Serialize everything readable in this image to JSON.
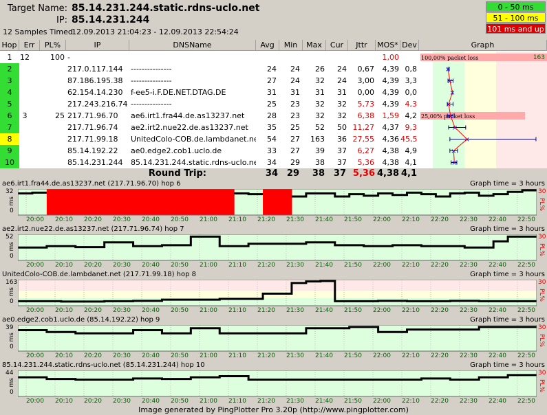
{
  "header": {
    "target_label": "Target Name:",
    "target_value": "85.14.231.244.static.rdns-uclo.net",
    "ip_label": "IP:",
    "ip_value": "85.14.231.244",
    "samples_label": "12 Samples Timed:",
    "samples_value": "12.09.2013 21:04:23 - 12.09.2013 22:54:24",
    "legend": [
      {
        "label": "0 - 50 ms",
        "bg": "#33dd33",
        "fg": "#000000"
      },
      {
        "label": "51 - 100 ms",
        "bg": "#ffff00",
        "fg": "#000000"
      },
      {
        "label": "101 ms and up",
        "bg": "#e00000",
        "fg": "#ffffff"
      }
    ]
  },
  "columns": [
    "Hop",
    "Err",
    "PL%",
    "IP",
    "DNSName",
    "Avg",
    "Min",
    "Max",
    "Cur",
    "Jttr",
    "MOS*",
    "Dev",
    "Graph"
  ],
  "rows": [
    {
      "hop": "1",
      "err": "12",
      "pl": "100",
      "ip": "-",
      "dns": "",
      "avg": "",
      "min": "",
      "max": "",
      "cur": "",
      "jttr": "",
      "mos": "1,00",
      "dev": "",
      "hopcolor": "white",
      "mosred": true,
      "jttrred": false,
      "devred": false,
      "pltext": "100,00% packet loss",
      "plpct": 100,
      "plcount": "163",
      "g_avg": null,
      "g_min": null,
      "g_max": null
    },
    {
      "hop": "2",
      "err": "",
      "pl": "",
      "ip": "217.0.117.144",
      "dns": "---------------",
      "avg": "24",
      "min": "24",
      "max": "26",
      "cur": "24",
      "jttr": "0,67",
      "mos": "4,39",
      "dev": "0,8",
      "hopcolor": "green",
      "mosred": false,
      "jttrred": false,
      "devred": false,
      "pltext": "",
      "plpct": 0,
      "plcount": "",
      "g_avg": 24,
      "g_min": 24,
      "g_max": 26
    },
    {
      "hop": "3",
      "err": "",
      "pl": "",
      "ip": "87.186.195.38",
      "dns": "---------------",
      "avg": "27",
      "min": "24",
      "max": "32",
      "cur": "24",
      "jttr": "3,00",
      "mos": "4,39",
      "dev": "3,3",
      "hopcolor": "green",
      "mosred": false,
      "jttrred": false,
      "devred": false,
      "pltext": "",
      "plpct": 0,
      "plcount": "",
      "g_avg": 27,
      "g_min": 24,
      "g_max": 32
    },
    {
      "hop": "4",
      "err": "",
      "pl": "",
      "ip": "62.154.14.230",
      "dns": "f-ee5-i.F.DE.NET.DTAG.DE",
      "avg": "31",
      "min": "31",
      "max": "31",
      "cur": "31",
      "jttr": "0,00",
      "mos": "4,39",
      "dev": "0,0",
      "hopcolor": "green",
      "mosred": false,
      "jttrred": false,
      "devred": false,
      "pltext": "",
      "plpct": 0,
      "plcount": "",
      "g_avg": 31,
      "g_min": 31,
      "g_max": 31
    },
    {
      "hop": "5",
      "err": "",
      "pl": "",
      "ip": "217.243.216.74",
      "dns": "---------------",
      "avg": "25",
      "min": "23",
      "max": "32",
      "cur": "32",
      "jttr": "5,73",
      "mos": "4,39",
      "dev": "4,3",
      "hopcolor": "green",
      "mosred": false,
      "jttrred": true,
      "devred": true,
      "pltext": "",
      "plpct": 0,
      "plcount": "",
      "g_avg": 25,
      "g_min": 23,
      "g_max": 32
    },
    {
      "hop": "6",
      "err": "3",
      "pl": "25",
      "ip": "217.71.96.70",
      "dns": "ae6.irt1.fra44.de.as13237.net",
      "avg": "28",
      "min": "23",
      "max": "32",
      "cur": "32",
      "jttr": "6,38",
      "mos": "1,59",
      "dev": "4,2",
      "hopcolor": "green",
      "mosred": true,
      "jttrred": true,
      "devred": false,
      "pltext": "25,00% packet loss",
      "plpct": 25,
      "plcount": "",
      "g_avg": 28,
      "g_min": 23,
      "g_max": 32
    },
    {
      "hop": "7",
      "err": "",
      "pl": "",
      "ip": "217.71.96.74",
      "dns": "ae2.irt2.nue22.de.as13237.net",
      "avg": "35",
      "min": "25",
      "max": "52",
      "cur": "50",
      "jttr": "11,27",
      "mos": "4,37",
      "dev": "9,3",
      "hopcolor": "green",
      "mosred": false,
      "jttrred": true,
      "devred": true,
      "pltext": "",
      "plpct": 0,
      "plcount": "",
      "g_avg": 35,
      "g_min": 25,
      "g_max": 52
    },
    {
      "hop": "8",
      "err": "",
      "pl": "",
      "ip": "217.71.99.18",
      "dns": "UnitedColo-COB.de.lambdanet.net",
      "avg": "54",
      "min": "27",
      "max": "163",
      "cur": "36",
      "jttr": "27,55",
      "mos": "4,36",
      "dev": "45,5",
      "hopcolor": "yellow",
      "mosred": false,
      "jttrred": true,
      "devred": true,
      "pltext": "",
      "plpct": 0,
      "plcount": "",
      "g_avg": 54,
      "g_min": 27,
      "g_max": 163
    },
    {
      "hop": "9",
      "err": "",
      "pl": "",
      "ip": "85.14.192.22",
      "dns": "ae0.edge2.cob1.uclo.de",
      "avg": "33",
      "min": "27",
      "max": "39",
      "cur": "37",
      "jttr": "6,27",
      "mos": "4,38",
      "dev": "4,9",
      "hopcolor": "green",
      "mosred": false,
      "jttrred": true,
      "devred": false,
      "pltext": "",
      "plpct": 0,
      "plcount": "",
      "g_avg": 33,
      "g_min": 27,
      "g_max": 39
    },
    {
      "hop": "10",
      "err": "",
      "pl": "",
      "ip": "85.14.231.244",
      "dns": "85.14.231.244.static.rdns-uclo.net",
      "avg": "34",
      "min": "29",
      "max": "38",
      "cur": "37",
      "jttr": "5,36",
      "mos": "4,38",
      "dev": "4,1",
      "hopcolor": "green",
      "mosred": false,
      "jttrred": true,
      "devred": false,
      "pltext": "",
      "plpct": 0,
      "plcount": "",
      "g_avg": 34,
      "g_min": 29,
      "g_max": 38
    }
  ],
  "roundtrip": {
    "label": "Round Trip:",
    "avg": "34",
    "min": "29",
    "max": "38",
    "cur": "37",
    "jttr": "5,36",
    "mos": "4,38",
    "dev": "4,1"
  },
  "hop_graphs": [
    {
      "title": "ae6.irt1.fra44.de.as13237.net (217.71.96.70) hop 6",
      "time": "Graph time = 3 hours",
      "ymax": "32",
      "ymin": "0",
      "ylabel": "ms",
      "pl_max": "30",
      "pl_label": "PL%",
      "chart_max": 32,
      "values": [
        28,
        29,
        null,
        null,
        null,
        null,
        null,
        null,
        null,
        null,
        null,
        null,
        null,
        null,
        null,
        28,
        27,
        null,
        null,
        24,
        28,
        28,
        24,
        27,
        25,
        28,
        26,
        29,
        27,
        24,
        28,
        29,
        25,
        27,
        30,
        32
      ],
      "loss": [
        false,
        false,
        true,
        true,
        true,
        true,
        true,
        true,
        true,
        true,
        true,
        true,
        true,
        true,
        true,
        false,
        false,
        true,
        true,
        false,
        false,
        false,
        false,
        false,
        false,
        false,
        false,
        false,
        false,
        false,
        false,
        false,
        false,
        false,
        false,
        false
      ]
    },
    {
      "title": "ae2.irt2.nue22.de.as13237.net (217.71.96.74) hop 7",
      "time": "Graph time = 3 hours",
      "ymax": "52",
      "ymin": "0",
      "ylabel": "ms",
      "pl_max": "30",
      "pl_label": "PL%",
      "chart_max": 52,
      "values": [
        27,
        27,
        30,
        30,
        28,
        28,
        38,
        38,
        30,
        30,
        32,
        32,
        50,
        50,
        30,
        30,
        35,
        35,
        35,
        35,
        38,
        38,
        32,
        32,
        30,
        30,
        32,
        32,
        30,
        30,
        30,
        27,
        27,
        40,
        50,
        50
      ],
      "loss": []
    },
    {
      "title": "UnitedColo-COB.de.lambdanet.net (217.71.99.18) hop 8",
      "time": "Graph time = 3 hours",
      "ymax": "163",
      "ymin": "0",
      "ylabel": "ms",
      "pl_max": "30",
      "pl_label": "PL%",
      "chart_max": 163,
      "values": [
        30,
        30,
        30,
        28,
        28,
        28,
        30,
        30,
        32,
        32,
        40,
        40,
        40,
        40,
        45,
        45,
        45,
        80,
        80,
        150,
        160,
        163,
        30,
        30,
        30,
        32,
        32,
        30,
        30,
        30,
        32,
        32,
        30,
        30,
        30,
        30
      ],
      "loss": []
    },
    {
      "title": "ae0.edge2.cob1.uclo.de (85.14.192.22) hop 9",
      "time": "Graph time = 3 hours",
      "ymax": "39",
      "ymin": "0",
      "ylabel": "ms",
      "pl_max": "30",
      "pl_label": "PL%",
      "chart_max": 39,
      "values": [
        33,
        33,
        30,
        30,
        28,
        28,
        28,
        28,
        33,
        33,
        28,
        28,
        36,
        36,
        28,
        28,
        28,
        28,
        28,
        28,
        36,
        36,
        36,
        38,
        38,
        30,
        30,
        34,
        34,
        34,
        34,
        34,
        38,
        38,
        38,
        38
      ],
      "loss": []
    },
    {
      "title": "85.14.231.244.static.rdns-uclo.net (85.14.231.244) hop 10",
      "time": "Graph time = 3 hours",
      "ymax": "44",
      "ymin": "0",
      "ylabel": "ms",
      "pl_max": "30",
      "pl_label": "PL%",
      "chart_max": 44,
      "values": [
        34,
        34,
        31,
        31,
        30,
        30,
        30,
        30,
        32,
        32,
        31,
        31,
        34,
        34,
        36,
        36,
        30,
        30,
        30,
        30,
        30,
        30,
        30,
        30,
        30,
        30,
        30,
        30,
        32,
        32,
        30,
        30,
        34,
        34,
        38,
        38
      ],
      "loss": []
    }
  ],
  "x_ticks": [
    "20:00",
    "20:10",
    "20:20",
    "20:30",
    "20:40",
    "20:50",
    "21:00",
    "21:10",
    "21:20",
    "21:30",
    "21:40",
    "21:50",
    "22:00",
    "22:10",
    "22:20",
    "22:30",
    "22:40",
    "22:50"
  ],
  "footer": "Image generated by PingPlotter Pro 3.20p (http://www.pingplotter.com)",
  "colors": {
    "green_zone": "#ddffdd",
    "yellow_zone": "#ffffdd",
    "red_zone": "#ffe8e8",
    "loss": "#ff0000",
    "hop_green": "#33dd33",
    "hop_yellow": "#ffff00"
  }
}
